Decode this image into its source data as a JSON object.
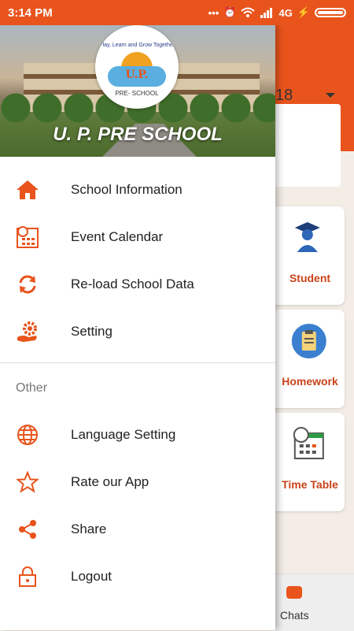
{
  "status_bar": {
    "time": "3:14 PM",
    "network": "4G"
  },
  "background": {
    "year_value": "18",
    "tiles": [
      {
        "label": "Student",
        "icon": "student-icon"
      },
      {
        "label": "Homework",
        "icon": "clipboard-icon"
      },
      {
        "label": "Time Table",
        "icon": "timetable-icon"
      }
    ],
    "chats_label": "Chats"
  },
  "drawer": {
    "school_name": "U. P. PRE SCHOOL",
    "logo": {
      "tagline": "Play, Learn and Grow Together",
      "initials": "U.P.",
      "subtitle": "PRE- SCHOOL"
    },
    "main_items": [
      {
        "label": "School Information",
        "icon": "home-icon"
      },
      {
        "label": "Event Calendar",
        "icon": "calendar-icon"
      },
      {
        "label": "Re-load School Data",
        "icon": "reload-icon"
      },
      {
        "label": "Setting",
        "icon": "settings-gear-icon"
      }
    ],
    "other_section_label": "Other",
    "other_items": [
      {
        "label": "Language Setting",
        "icon": "globe-icon"
      },
      {
        "label": "Rate our App",
        "icon": "star-icon"
      },
      {
        "label": "Share",
        "icon": "share-icon"
      },
      {
        "label": "Logout",
        "icon": "lock-icon"
      }
    ]
  },
  "colors": {
    "accent": "#e8541c",
    "tile_label": "#c9431a"
  }
}
